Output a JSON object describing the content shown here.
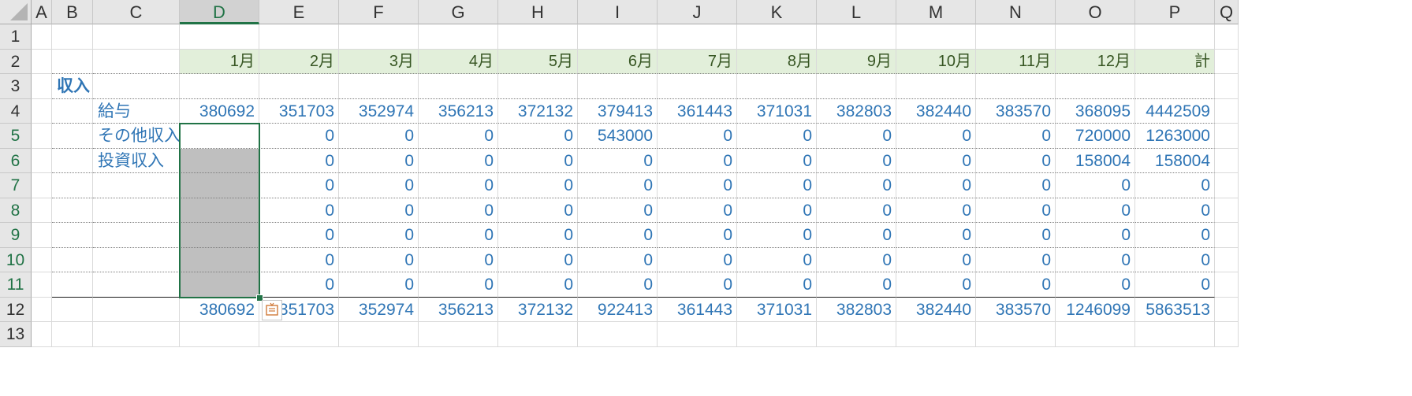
{
  "columns": [
    "A",
    "B",
    "C",
    "D",
    "E",
    "F",
    "G",
    "H",
    "I",
    "J",
    "K",
    "L",
    "M",
    "N",
    "O",
    "P",
    "Q"
  ],
  "rows": [
    "1",
    "2",
    "3",
    "4",
    "5",
    "6",
    "7",
    "8",
    "9",
    "10",
    "11",
    "12",
    "13"
  ],
  "months": [
    "1月",
    "2月",
    "3月",
    "4月",
    "5月",
    "6月",
    "7月",
    "8月",
    "9月",
    "10月",
    "11月",
    "12月",
    "計"
  ],
  "section_label": "収入",
  "income_rows": [
    {
      "label": "給与",
      "values": [
        "380692",
        "351703",
        "352974",
        "356213",
        "372132",
        "379413",
        "361443",
        "371031",
        "382803",
        "382440",
        "383570",
        "368095",
        "4442509"
      ]
    },
    {
      "label": "その他収入",
      "values": [
        "",
        "0",
        "0",
        "0",
        "0",
        "543000",
        "0",
        "0",
        "0",
        "0",
        "0",
        "720000",
        "1263000"
      ]
    },
    {
      "label": "投資収入",
      "values": [
        "",
        "0",
        "0",
        "0",
        "0",
        "0",
        "0",
        "0",
        "0",
        "0",
        "0",
        "158004",
        "158004"
      ]
    },
    {
      "label": "",
      "values": [
        "",
        "0",
        "0",
        "0",
        "0",
        "0",
        "0",
        "0",
        "0",
        "0",
        "0",
        "0",
        "0"
      ]
    },
    {
      "label": "",
      "values": [
        "",
        "0",
        "0",
        "0",
        "0",
        "0",
        "0",
        "0",
        "0",
        "0",
        "0",
        "0",
        "0"
      ]
    },
    {
      "label": "",
      "values": [
        "",
        "0",
        "0",
        "0",
        "0",
        "0",
        "0",
        "0",
        "0",
        "0",
        "0",
        "0",
        "0"
      ]
    },
    {
      "label": "",
      "values": [
        "",
        "0",
        "0",
        "0",
        "0",
        "0",
        "0",
        "0",
        "0",
        "0",
        "0",
        "0",
        "0"
      ]
    },
    {
      "label": "",
      "values": [
        "",
        "0",
        "0",
        "0",
        "0",
        "0",
        "0",
        "0",
        "0",
        "0",
        "0",
        "0",
        "0"
      ]
    }
  ],
  "totals": [
    "380692",
    "351703",
    "352974",
    "356213",
    "372132",
    "922413",
    "361443",
    "371031",
    "382803",
    "382440",
    "383570",
    "1246099",
    "5863513"
  ],
  "selection": {
    "column": "D",
    "rows": "5:11"
  },
  "quick_analysis_icon": "quick-analysis-icon",
  "colors": {
    "header_fill": "#e2efda",
    "value_text": "#2f75b5",
    "selection_border": "#217346",
    "selection_fill": "#bfbfbf"
  }
}
